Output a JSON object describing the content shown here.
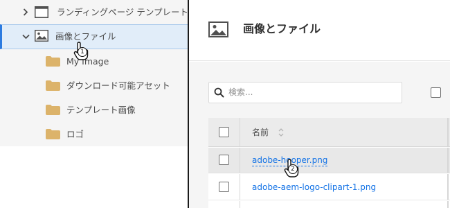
{
  "tree": {
    "items": [
      {
        "label": "ランディングページ テンプレート",
        "icon": "page-template-icon",
        "expanded": false
      },
      {
        "label": "画像とファイル",
        "icon": "image-icon",
        "expanded": true,
        "selected": true
      },
      {
        "label": "My Image",
        "icon": "folder-icon"
      },
      {
        "label": "ダウンロード可能アセット",
        "icon": "folder-icon"
      },
      {
        "label": "テンプレート画像",
        "icon": "folder-icon"
      },
      {
        "label": "ロゴ",
        "icon": "folder-icon"
      }
    ],
    "cursor_step": "1"
  },
  "asset_panel": {
    "title": "画像とファイル",
    "search": {
      "placeholder": "検索..."
    },
    "table": {
      "name_header": "名前",
      "rows": [
        {
          "name": "adobe-hooper.png",
          "hovered": true
        },
        {
          "name": "adobe-aem-logo-clipart-1.png",
          "hovered": false
        }
      ]
    },
    "cursor_step": "2"
  },
  "colors": {
    "link": "#1473e6",
    "selection_bar": "#2c7be0",
    "selection_bg": "#e1edf9",
    "folder": "#dcb36a",
    "panel_bg": "#f5f5f5"
  }
}
